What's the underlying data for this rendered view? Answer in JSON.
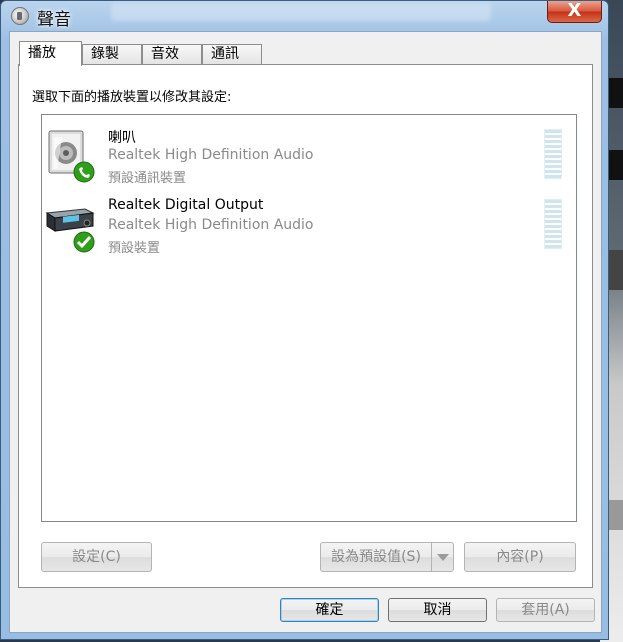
{
  "window": {
    "title": "聲音",
    "close_label": "X"
  },
  "tabs": [
    {
      "label": "播放",
      "active": true
    },
    {
      "label": "錄製",
      "active": false
    },
    {
      "label": "音效",
      "active": false
    },
    {
      "label": "通訊",
      "active": false
    }
  ],
  "instruction": "選取下面的播放裝置以修改其設定:",
  "devices": [
    {
      "name": "喇叭",
      "driver": "Realtek High Definition Audio",
      "status": "預設通訊裝置",
      "icon": "speaker-icon",
      "badge": "phone-icon"
    },
    {
      "name": "Realtek Digital Output",
      "driver": "Realtek High Definition Audio",
      "status": "預設裝置",
      "icon": "digital-output-icon",
      "badge": "check-icon"
    }
  ],
  "buttons": {
    "configure": "設定(C)",
    "set_default": "設為預設值(S)",
    "properties": "內容(P)",
    "ok": "確定",
    "cancel": "取消",
    "apply": "套用(A)"
  },
  "colors": {
    "badge_green": "#2f9e1a",
    "accent_blue": "#3c7fb1",
    "close_red": "#c63016"
  }
}
